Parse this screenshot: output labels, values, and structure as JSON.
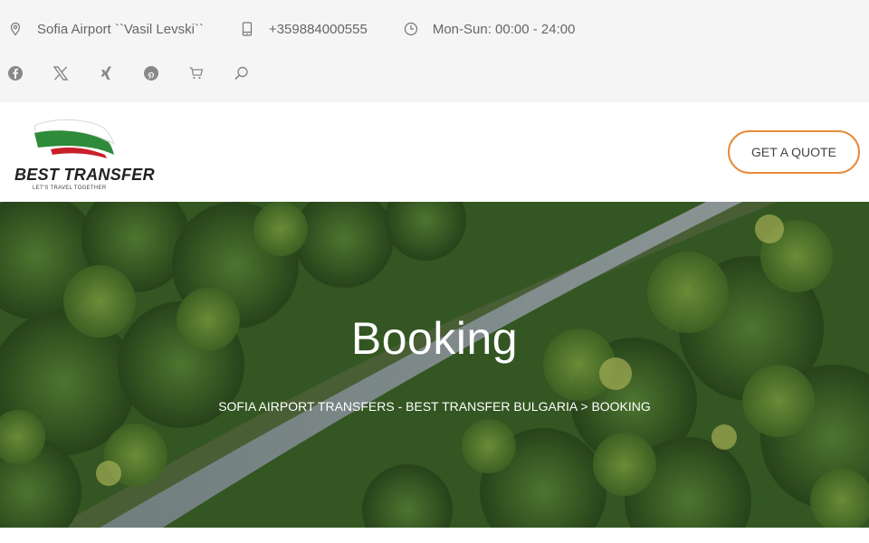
{
  "topbar": {
    "location": "Sofia Airport ``Vasil Levski``",
    "phone": "+359884000555",
    "hours": "Mon-Sun: 00:00 - 24:00"
  },
  "logo": {
    "name": "BEST TRANSFER",
    "tagline": "LET'S TRAVEL TOGETHER"
  },
  "header": {
    "quote_button": "GET A QUOTE"
  },
  "hero": {
    "title": "Booking",
    "breadcrumb": {
      "home": "SOFIA AIRPORT TRANSFERS - BEST TRANSFER BULGARIA",
      "separator": ">",
      "current": "BOOKING"
    }
  },
  "icons": {
    "location": "map-pin-icon",
    "phone": "phone-icon",
    "hours": "clock-icon",
    "social": [
      "facebook-icon",
      "x-icon",
      "xing-icon",
      "pinterest-icon"
    ],
    "cart": "cart-icon",
    "search": "search-icon"
  },
  "colors": {
    "accent": "#e98a3a",
    "topbar_bg": "#f5f5f5"
  }
}
